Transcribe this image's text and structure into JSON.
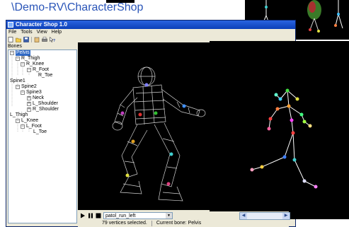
{
  "banner": {
    "path": "\\Demo-RV\\CharacterShop"
  },
  "window": {
    "title": "Character Shop 1.0"
  },
  "menu": [
    {
      "label": "File"
    },
    {
      "label": "Tools"
    },
    {
      "label": "View"
    },
    {
      "label": "Help"
    }
  ],
  "panel": {
    "label": "Bones"
  },
  "tree": [
    {
      "label": "Pelvis",
      "toggle": "−",
      "selected": true
    },
    {
      "label": "R_Thigh",
      "toggle": "−"
    },
    {
      "label": "R_Knee",
      "toggle": "−"
    },
    {
      "label": "R_Foot",
      "toggle": "−"
    },
    {
      "label": "R_Toe",
      "toggle": ""
    },
    {
      "label": "Spine1",
      "toggle": "−"
    },
    {
      "label": "Spine2",
      "toggle": "−"
    },
    {
      "label": "Spine3",
      "toggle": "−"
    },
    {
      "label": "Neck",
      "toggle": "+"
    },
    {
      "label": "L_Shoulder",
      "toggle": "+"
    },
    {
      "label": "R_Shoulder",
      "toggle": "+"
    },
    {
      "label": "L_Thigh",
      "toggle": "−"
    },
    {
      "label": "L_Knee",
      "toggle": "−"
    },
    {
      "label": "L_Foot",
      "toggle": "−"
    },
    {
      "label": "L_Toe",
      "toggle": ""
    }
  ],
  "playback": {
    "animation": "patol_run_left"
  },
  "status": {
    "vertices": "79 vertices selected.",
    "bone": "Current bone: Pelvis"
  },
  "colors": {
    "accent": "#2a55b8",
    "titlebar": "#0b3fb8",
    "viewport_bg": "#000000",
    "wireframe": "#e8e8e8",
    "bone_line": "#ffffff"
  }
}
